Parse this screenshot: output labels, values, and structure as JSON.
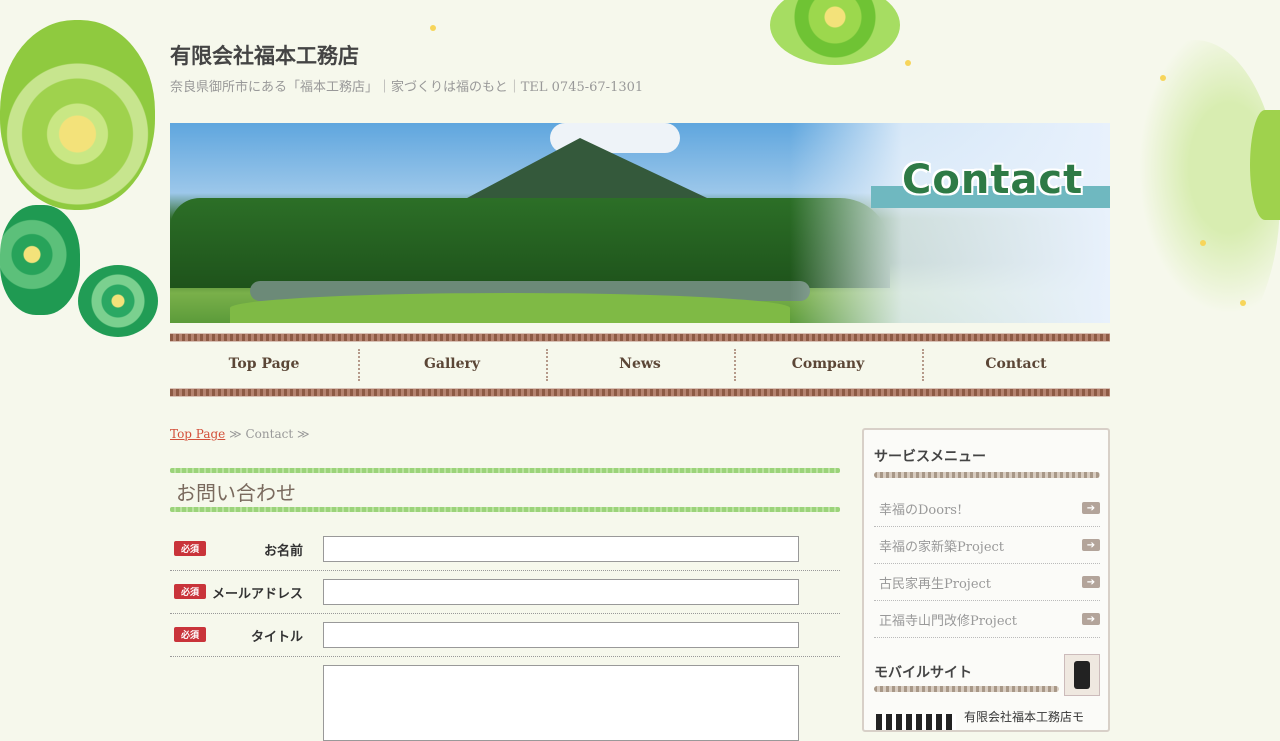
{
  "site": {
    "title": "有限会社福本工務店",
    "tagline": "奈良県御所市にある「福本工務店」｜家づくりは福のもと｜TEL 0745-67-1301"
  },
  "banner": {
    "heading": "Contact"
  },
  "nav": {
    "items": [
      "Top Page",
      "Gallery",
      "News",
      "Company",
      "Contact"
    ]
  },
  "breadcrumb": {
    "home": "Top Page",
    "separator": "≫",
    "current": "Contact"
  },
  "page": {
    "heading": "お問い合わせ"
  },
  "form": {
    "required_badge": "必須",
    "fields": [
      {
        "label": "お名前",
        "value": ""
      },
      {
        "label": "メールアドレス",
        "value": ""
      },
      {
        "label": "タイトル",
        "value": ""
      }
    ],
    "message_value": ""
  },
  "sidebar": {
    "service_title": "サービスメニュー",
    "service_items": [
      "幸福のDoors!",
      "幸福の家新築Project",
      "古民家再生Project",
      "正福寺山門改修Project"
    ],
    "mobile_title": "モバイルサイト",
    "mobile_text": "有限会社福本工務店モ"
  },
  "icons": {
    "menu_arrow": "arrow-right-icon",
    "mobile": "smartphone-icon"
  },
  "colors": {
    "link": "#d3503a",
    "required": "#c9343a",
    "nav_text": "#5b4636",
    "heading_rule": "#9bd37a"
  }
}
